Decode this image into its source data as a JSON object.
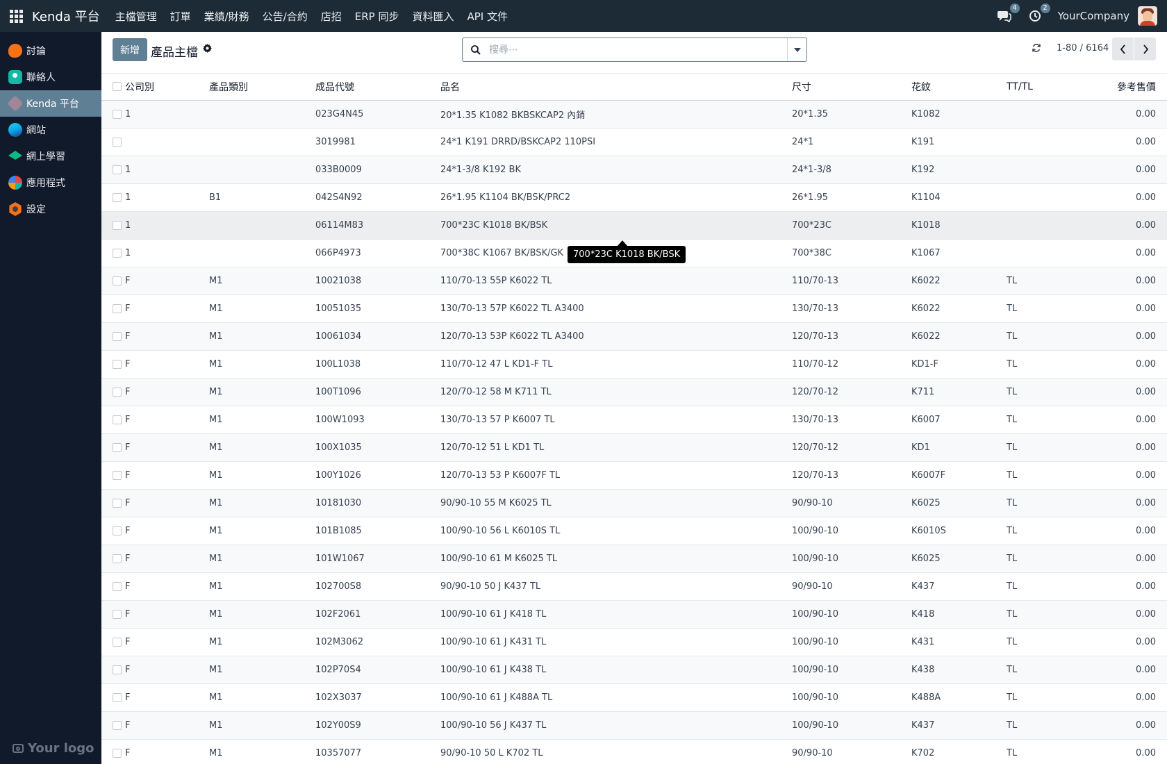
{
  "topbar": {
    "brand": "Kenda 平台",
    "menu": [
      "主檔管理",
      "訂單",
      "業績/財務",
      "公告/合約",
      "店招",
      "ERP 同步",
      "資料匯入",
      "API 文件"
    ],
    "messages_count": "4",
    "activity_count": "2",
    "company": "YourCompany"
  },
  "sidebar": {
    "items": [
      {
        "label": "討論",
        "icon": "discuss-icon"
      },
      {
        "label": "聯絡人",
        "icon": "contacts-icon"
      },
      {
        "label": "Kenda 平台",
        "icon": "kenda-icon",
        "active": true
      },
      {
        "label": "網站",
        "icon": "website-icon"
      },
      {
        "label": "網上學習",
        "icon": "elearning-icon"
      },
      {
        "label": "應用程式",
        "icon": "apps-icon"
      },
      {
        "label": "設定",
        "icon": "settings-icon"
      }
    ],
    "logo_text": "Your logo"
  },
  "control": {
    "new_label": "新增",
    "title": "產品主檔",
    "search_placeholder": "搜尋⋯",
    "pager": "1-80 / 6164"
  },
  "table": {
    "headers": [
      "公司別",
      "產品類別",
      "成品代號",
      "品名",
      "尺寸",
      "花紋",
      "TT/TL",
      "參考售價"
    ],
    "rows": [
      [
        "1",
        "",
        "023G4N45",
        "20*1.35 K1082 BKBSKCAP2 內銷",
        "20*1.35",
        "K1082",
        "",
        "0.00"
      ],
      [
        "",
        "",
        "3019981",
        "24*1 K191 DRRD/BSKCAP2 110PSI",
        "24*1",
        "K191",
        "",
        "0.00"
      ],
      [
        "1",
        "",
        "033B0009",
        "24*1-3/8 K192 BK",
        "24*1-3/8",
        "K192",
        "",
        "0.00"
      ],
      [
        "1",
        "B1",
        "042S4N92",
        "26*1.95 K1104 BK/BSK/PRC2",
        "26*1.95",
        "K1104",
        "",
        "0.00"
      ],
      [
        "1",
        "",
        "06114M83",
        "700*23C K1018 BK/BSK",
        "700*23C",
        "K1018",
        "",
        "0.00"
      ],
      [
        "1",
        "",
        "066P4973",
        "700*38C K1067 BK/BSK/GK",
        "700*38C",
        "K1067",
        "",
        "0.00"
      ],
      [
        "F",
        "M1",
        "10021038",
        "110/70-13 55P K6022 TL",
        "110/70-13",
        "K6022",
        "TL",
        "0.00"
      ],
      [
        "F",
        "M1",
        "10051035",
        "130/70-13 57P K6022 TL A3400",
        "130/70-13",
        "K6022",
        "TL",
        "0.00"
      ],
      [
        "F",
        "M1",
        "10061034",
        "120/70-13 53P K6022 TL A3400",
        "120/70-13",
        "K6022",
        "TL",
        "0.00"
      ],
      [
        "F",
        "M1",
        "100L1038",
        "110/70-12 47 L KD1-F TL",
        "110/70-12",
        "KD1-F",
        "TL",
        "0.00"
      ],
      [
        "F",
        "M1",
        "100T1096",
        "120/70-12 58 M K711 TL",
        "120/70-12",
        "K711",
        "TL",
        "0.00"
      ],
      [
        "F",
        "M1",
        "100W1093",
        "130/70-13 57 P K6007 TL",
        "130/70-13",
        "K6007",
        "TL",
        "0.00"
      ],
      [
        "F",
        "M1",
        "100X1035",
        "120/70-12 51 L KD1 TL",
        "120/70-12",
        "KD1",
        "TL",
        "0.00"
      ],
      [
        "F",
        "M1",
        "100Y1026",
        "120/70-13 53 P K6007F TL",
        "120/70-13",
        "K6007F",
        "TL",
        "0.00"
      ],
      [
        "F",
        "M1",
        "10181030",
        "90/90-10 55 M K6025 TL",
        "90/90-10",
        "K6025",
        "TL",
        "0.00"
      ],
      [
        "F",
        "M1",
        "101B1085",
        "100/90-10 56 L K6010S TL",
        "100/90-10",
        "K6010S",
        "TL",
        "0.00"
      ],
      [
        "F",
        "M1",
        "101W1067",
        "100/90-10 61 M K6025 TL",
        "100/90-10",
        "K6025",
        "TL",
        "0.00"
      ],
      [
        "F",
        "M1",
        "102700S8",
        "90/90-10 50 J K437 TL",
        "90/90-10",
        "K437",
        "TL",
        "0.00"
      ],
      [
        "F",
        "M1",
        "102F2061",
        "100/90-10 61 J K418 TL",
        "100/90-10",
        "K418",
        "TL",
        "0.00"
      ],
      [
        "F",
        "M1",
        "102M3062",
        "100/90-10 61 J K431 TL",
        "100/90-10",
        "K431",
        "TL",
        "0.00"
      ],
      [
        "F",
        "M1",
        "102P70S4",
        "100/90-10 61 J K438 TL",
        "100/90-10",
        "K438",
        "TL",
        "0.00"
      ],
      [
        "F",
        "M1",
        "102X3037",
        "100/90-10 61 J K488A TL",
        "100/90-10",
        "K488A",
        "TL",
        "0.00"
      ],
      [
        "F",
        "M1",
        "102Y00S9",
        "100/90-10 56 J K437 TL",
        "100/90-10",
        "K437",
        "TL",
        "0.00"
      ],
      [
        "F",
        "M1",
        "10357077",
        "90/90-10 50 L K702 TL",
        "90/90-10",
        "K702",
        "TL",
        "0.00"
      ]
    ],
    "hover_row": 4
  },
  "tooltip": {
    "text": "700*23C K1018 BK/BSK"
  },
  "colors": {
    "navbar": "#1d2b36",
    "sidebar": "#111a2a",
    "accent": "#5f7f95"
  }
}
